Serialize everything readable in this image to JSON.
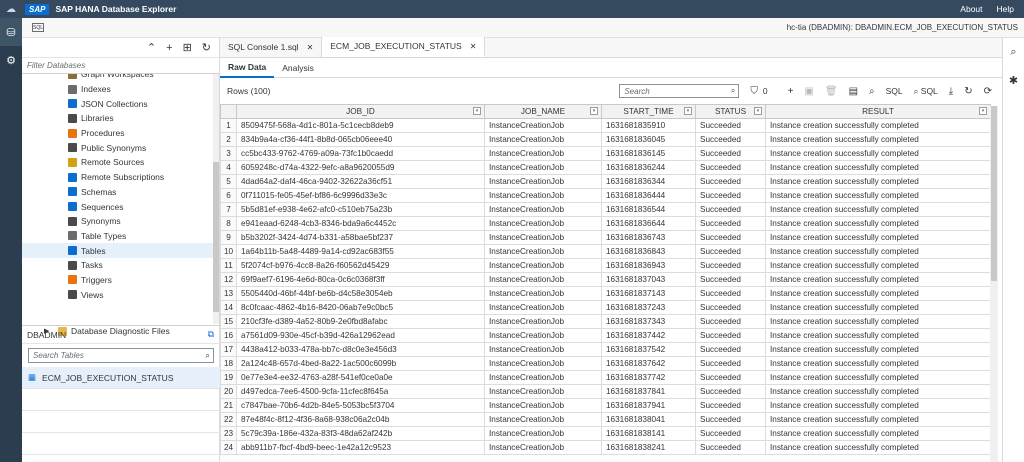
{
  "shell": {
    "logo": "SAP",
    "title": "SAP HANA Database Explorer",
    "about": "About",
    "help": "Help"
  },
  "subheader": {
    "connection": "hc-tia (DBADMIN): DBADMIN.ECM_JOB_EXECUTION_STATUS"
  },
  "left": {
    "filter_placeholder": "Filter Databases",
    "tree": [
      {
        "label": "Graph Workspaces",
        "color": "#8a6d3b"
      },
      {
        "label": "Indexes",
        "color": "#6a6d70"
      },
      {
        "label": "JSON Collections",
        "color": "#0a6ed1"
      },
      {
        "label": "Libraries",
        "color": "#4a4a4a"
      },
      {
        "label": "Procedures",
        "color": "#e9730c"
      },
      {
        "label": "Public Synonyms",
        "color": "#4a4a4a"
      },
      {
        "label": "Remote Sources",
        "color": "#d4a017"
      },
      {
        "label": "Remote Subscriptions",
        "color": "#0a6ed1"
      },
      {
        "label": "Schemas",
        "color": "#0a6ed1"
      },
      {
        "label": "Sequences",
        "color": "#0a6ed1"
      },
      {
        "label": "Synonyms",
        "color": "#4a4a4a"
      },
      {
        "label": "Table Types",
        "color": "#6a6d70"
      },
      {
        "label": "Tables",
        "color": "#0a6ed1"
      },
      {
        "label": "Tasks",
        "color": "#4a4a4a"
      },
      {
        "label": "Triggers",
        "color": "#e9730c"
      },
      {
        "label": "Views",
        "color": "#4a4a4a"
      }
    ],
    "tree_folder": "Database Diagnostic Files",
    "db_panel": {
      "title": "DBADMIN",
      "search_placeholder": "Search Tables",
      "table": "ECM_JOB_EXECUTION_STATUS"
    }
  },
  "tabs": [
    {
      "label": "SQL Console 1.sql"
    },
    {
      "label": "ECM_JOB_EXECUTION_STATUS"
    }
  ],
  "subtabs": {
    "raw": "Raw Data",
    "analysis": "Analysis"
  },
  "grid": {
    "rows_label": "Rows (100)",
    "search_placeholder": "Search",
    "filter_count": "0",
    "sql1": "SQL",
    "sql2": "SQL",
    "columns": [
      "JOB_ID",
      "JOB_NAME",
      "START_TIME",
      "STATUS",
      "RESULT"
    ],
    "rows": [
      [
        "1",
        "8509475f-568a-4d1c-801a-5c1cecb8deb9",
        "InstanceCreationJob",
        "1631681835910",
        "Succeeded",
        "Instance creation successfully completed"
      ],
      [
        "2",
        "834b9a4a-cf36-44f1-8b8d-065cb06eee40",
        "InstanceCreationJob",
        "1631681836045",
        "Succeeded",
        "Instance creation successfully completed"
      ],
      [
        "3",
        "cc5bc433-9762-4769-a09a-73fc1b0caedd",
        "InstanceCreationJob",
        "1631681836145",
        "Succeeded",
        "Instance creation successfully completed"
      ],
      [
        "4",
        "6059248c-d74a-4322-9efc-a8a9620055d9",
        "InstanceCreationJob",
        "1631681836244",
        "Succeeded",
        "Instance creation successfully completed"
      ],
      [
        "5",
        "4dad64a2-daf4-46ca-9402-32622a36cf51",
        "InstanceCreationJob",
        "1631681836344",
        "Succeeded",
        "Instance creation successfully completed"
      ],
      [
        "6",
        "0f711015-fe05-45ef-bf86-6c9996d33e3c",
        "InstanceCreationJob",
        "1631681836444",
        "Succeeded",
        "Instance creation successfully completed"
      ],
      [
        "7",
        "5b5d81ef-e938-4e62-afc0-c510eb75a23b",
        "InstanceCreationJob",
        "1631681836544",
        "Succeeded",
        "Instance creation successfully completed"
      ],
      [
        "8",
        "e941eaad-6248-4cb3-8346-bda9a6c4452c",
        "InstanceCreationJob",
        "1631681836644",
        "Succeeded",
        "Instance creation successfully completed"
      ],
      [
        "9",
        "b5b3202f-3424-4d74-b331-a58bae5bf237",
        "InstanceCreationJob",
        "1631681836743",
        "Succeeded",
        "Instance creation successfully completed"
      ],
      [
        "10",
        "1a64b11b-5a48-4489-9a14-cd92ac683f55",
        "InstanceCreationJob",
        "1631681836843",
        "Succeeded",
        "Instance creation successfully completed"
      ],
      [
        "11",
        "5f2074cf-b976-4cc8-8a26-f60562d45429",
        "InstanceCreationJob",
        "1631681836943",
        "Succeeded",
        "Instance creation successfully completed"
      ],
      [
        "12",
        "69f9aef7-6196-4e6d-80ca-0c6c0368f3ff",
        "InstanceCreationJob",
        "1631681837043",
        "Succeeded",
        "Instance creation successfully completed"
      ],
      [
        "13",
        "5505440d-46bf-44bf-be6b-d4c58e3054eb",
        "InstanceCreationJob",
        "1631681837143",
        "Succeeded",
        "Instance creation successfully completed"
      ],
      [
        "14",
        "8c0fcaac-4862-4b16-8420-06ab7e9c0bc5",
        "InstanceCreationJob",
        "1631681837243",
        "Succeeded",
        "Instance creation successfully completed"
      ],
      [
        "15",
        "210cf3fe-d389-4a52-80b9-2e0fbd8afabc",
        "InstanceCreationJob",
        "1631681837343",
        "Succeeded",
        "Instance creation successfully completed"
      ],
      [
        "16",
        "a7561d09-930e-45cf-b39d-426a12962ead",
        "InstanceCreationJob",
        "1631681837442",
        "Succeeded",
        "Instance creation successfully completed"
      ],
      [
        "17",
        "4438a412-b033-478a-bb7c-d8c0e3e456d3",
        "InstanceCreationJob",
        "1631681837542",
        "Succeeded",
        "Instance creation successfully completed"
      ],
      [
        "18",
        "2a124c48-657d-4bed-8a22-1ac500c6099b",
        "InstanceCreationJob",
        "1631681837642",
        "Succeeded",
        "Instance creation successfully completed"
      ],
      [
        "19",
        "0e77e3e4-ee32-4763-a28f-541ef0ce0a0e",
        "InstanceCreationJob",
        "1631681837742",
        "Succeeded",
        "Instance creation successfully completed"
      ],
      [
        "20",
        "d497edca-7ee6-4500-9cfa-11cfec8f645a",
        "InstanceCreationJob",
        "1631681837841",
        "Succeeded",
        "Instance creation successfully completed"
      ],
      [
        "21",
        "c7847bae-70b6-4d2b-84e5-5053bc5f3704",
        "InstanceCreationJob",
        "1631681837941",
        "Succeeded",
        "Instance creation successfully completed"
      ],
      [
        "22",
        "87e48f4c-8f12-4f36-8a68-938c06a2c04b",
        "InstanceCreationJob",
        "1631681838041",
        "Succeeded",
        "Instance creation successfully completed"
      ],
      [
        "23",
        "5c79c39a-186e-432a-83f3-48da62af242b",
        "InstanceCreationJob",
        "1631681838141",
        "Succeeded",
        "Instance creation successfully completed"
      ],
      [
        "24",
        "abb911b7-fbcf-4bd9-beec-1e42a12c9523",
        "InstanceCreationJob",
        "1631681838241",
        "Succeeded",
        "Instance creation successfully completed"
      ]
    ]
  }
}
